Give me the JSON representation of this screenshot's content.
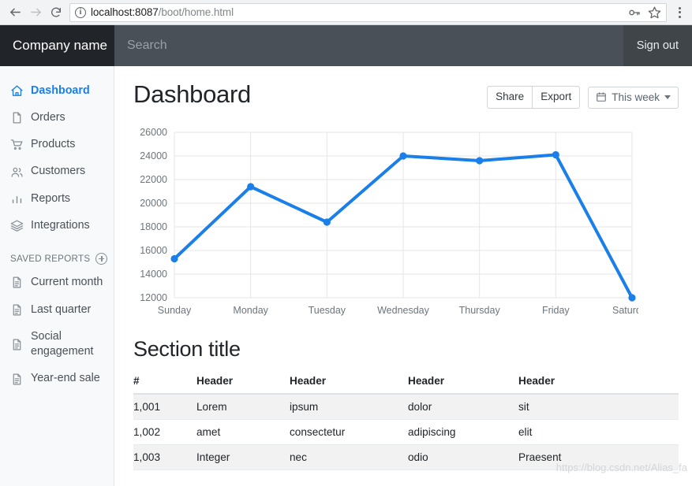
{
  "browser": {
    "back_icon": "back-arrow-icon",
    "forward_icon": "forward-arrow-icon",
    "reload_icon": "reload-icon",
    "info_icon": "ⓘ",
    "url_host": "localhost:8087",
    "url_path": "/boot/home.html",
    "key_icon": "key-icon",
    "star_icon": "star-icon",
    "menu_icon": "kebab-menu-icon"
  },
  "navbar": {
    "brand": "Company name",
    "search_placeholder": "Search",
    "search_value": "",
    "signout": "Sign out"
  },
  "sidebar": {
    "items": [
      {
        "label": "Dashboard",
        "icon": "home-icon",
        "active": true
      },
      {
        "label": "Orders",
        "icon": "file-icon",
        "active": false
      },
      {
        "label": "Products",
        "icon": "cart-icon",
        "active": false
      },
      {
        "label": "Customers",
        "icon": "people-icon",
        "active": false
      },
      {
        "label": "Reports",
        "icon": "bar-chart-icon",
        "active": false
      },
      {
        "label": "Integrations",
        "icon": "layers-icon",
        "active": false
      }
    ],
    "saved_reports_heading": "SAVED REPORTS",
    "add_icon": "plus-circle-icon",
    "saved_reports": [
      {
        "label": "Current month",
        "icon": "document-icon"
      },
      {
        "label": "Last quarter",
        "icon": "document-icon"
      },
      {
        "label": "Social engagement",
        "icon": "document-icon"
      },
      {
        "label": "Year-end sale",
        "icon": "document-icon"
      }
    ]
  },
  "main": {
    "page_title": "Dashboard",
    "share_label": "Share",
    "export_label": "Export",
    "range_label": "This week",
    "calendar_icon": "calendar-icon",
    "caret_icon": "caret-down-icon",
    "section_title": "Section title",
    "table": {
      "headers": [
        "#",
        "Header",
        "Header",
        "Header",
        "Header"
      ],
      "rows": [
        [
          "1,001",
          "Lorem",
          "ipsum",
          "dolor",
          "sit"
        ],
        [
          "1,002",
          "amet",
          "consectetur",
          "adipiscing",
          "elit"
        ],
        [
          "1,003",
          "Integer",
          "nec",
          "odio",
          "Praesent"
        ]
      ]
    },
    "watermark": "https://blog.csdn.net/Alias_fa"
  },
  "colors": {
    "accent": "#1a7fe8",
    "navbar": "#495057",
    "brand_bg": "#212529",
    "sidebar_bg": "#f8f9fa"
  },
  "chart_data": {
    "type": "line",
    "title": "",
    "xlabel": "",
    "ylabel": "",
    "categories": [
      "Sunday",
      "Monday",
      "Tuesday",
      "Wednesday",
      "Thursday",
      "Friday",
      "Saturday"
    ],
    "values": [
      15300,
      21400,
      18400,
      24000,
      23600,
      24100,
      12000
    ],
    "series": [
      {
        "name": "",
        "values": [
          15300,
          21400,
          18400,
          24000,
          23600,
          24100,
          12000
        ]
      }
    ],
    "ylim": [
      12000,
      26000
    ],
    "yticks": [
      12000,
      14000,
      16000,
      18000,
      20000,
      22000,
      24000,
      26000
    ],
    "ytick_labels": [
      "12000",
      "14000",
      "16000",
      "18000",
      "20000",
      "22000",
      "24000",
      "26000"
    ],
    "grid": true,
    "legend": "none",
    "line_color": "#1a7fe8",
    "point_color": "#1a7fe8"
  }
}
